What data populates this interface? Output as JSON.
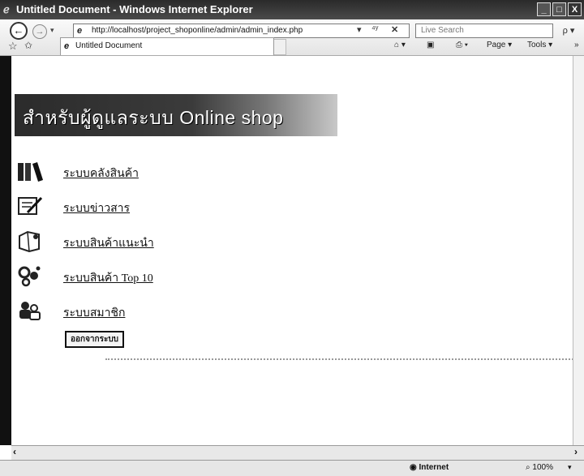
{
  "window": {
    "title": "Untitled Document - Windows Internet Explorer",
    "controls": {
      "minimize": "_",
      "maximize": "□",
      "close": "X"
    }
  },
  "address_bar": {
    "url": "http://localhost/project_shoponline/admin/admin_index.php",
    "search_placeholder": "Live Search",
    "search_button": "ρ ▾"
  },
  "tab": {
    "title": "Untitled Document"
  },
  "command_bar": {
    "home": "⌂ ▾",
    "feeds": "▣",
    "print": "⎙ ▾",
    "page": "Page ▾",
    "tools": "Tools ▾",
    "overflow": "»"
  },
  "page": {
    "banner_title": "สำหรับผู้ดูแลระบบ Online shop",
    "menu": [
      {
        "label": "ระบบคลังสินค้า",
        "icon": "books-icon"
      },
      {
        "label": "ระบบข่าวสาร",
        "icon": "news-icon"
      },
      {
        "label": "ระบบสินค้าแนะนำ",
        "icon": "recommended-products-icon"
      },
      {
        "label": "ระบบสินค้า Top 10",
        "icon": "top10-products-icon"
      },
      {
        "label": "ระบบสมาชิก",
        "icon": "members-icon"
      }
    ],
    "logout_button": "ออกจากระบบ"
  },
  "status_bar": {
    "zone": "Internet",
    "zoom": "100%"
  },
  "colors": {
    "banner_dark": "#2b2b2b",
    "chrome_dark": "#2a2a2a"
  }
}
